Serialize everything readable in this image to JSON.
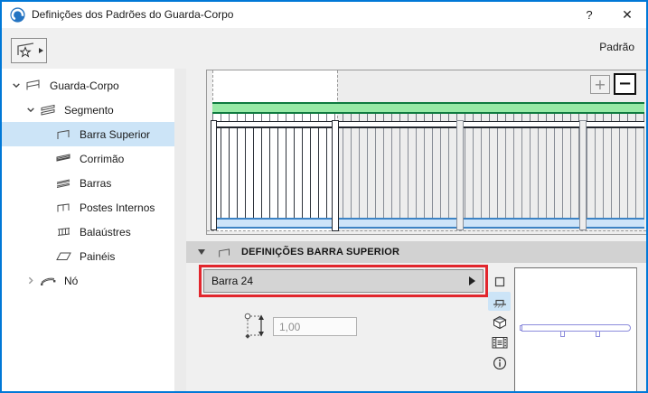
{
  "window": {
    "title": "Definições dos Padrões do Guarda-Corpo",
    "help_label": "?",
    "close_label": "✕"
  },
  "toolbar": {
    "favorites_icon": "favorites-star-icon",
    "scheme_label": "Padrão"
  },
  "tree": {
    "items": [
      {
        "label": "Guarda-Corpo",
        "level": 0,
        "icon": "railing-icon",
        "state": "expanded",
        "selected": false
      },
      {
        "label": "Segmento",
        "level": 1,
        "icon": "segment-icon",
        "state": "expanded",
        "selected": false
      },
      {
        "label": "Barra Superior",
        "level": 2,
        "icon": "top-rail-icon",
        "state": "leaf",
        "selected": true
      },
      {
        "label": "Corrimão",
        "level": 2,
        "icon": "handrail-icon",
        "state": "leaf",
        "selected": false
      },
      {
        "label": "Barras",
        "level": 2,
        "icon": "rails-icon",
        "state": "leaf",
        "selected": false
      },
      {
        "label": "Postes Internos",
        "level": 2,
        "icon": "inner-posts-icon",
        "state": "leaf",
        "selected": false
      },
      {
        "label": "Balaústres",
        "level": 2,
        "icon": "balusters-icon",
        "state": "leaf",
        "selected": false
      },
      {
        "label": "Painéis",
        "level": 2,
        "icon": "panels-icon",
        "state": "leaf",
        "selected": false
      },
      {
        "label": "Nó",
        "level": 1,
        "icon": "node-icon",
        "state": "collapsed",
        "selected": false
      }
    ]
  },
  "preview": {
    "zoom_in_label": "+",
    "zoom_out_label": "−"
  },
  "settings": {
    "section_title": "DEFINIÇÕES BARRA SUPERIOR",
    "profile_button_label": "Barra 24",
    "height_value": "1,00"
  },
  "view_toolbar": {
    "buttons": [
      {
        "icon": "plan-view-icon",
        "selected": false
      },
      {
        "icon": "front-view-icon",
        "selected": true
      },
      {
        "icon": "3d-view-icon",
        "selected": false
      },
      {
        "icon": "flythrough-icon",
        "selected": false
      },
      {
        "icon": "info-icon",
        "selected": false
      }
    ]
  },
  "colors": {
    "win_border": "#0078d7",
    "selection": "#cce4f7",
    "annotation_red": "#e2262d",
    "rail_green": "#97e9a6",
    "rail_green_border": "#0e7a3f",
    "rail_blue": "#cde4f9",
    "rail_blue_border": "#3d83c4",
    "mini_purple": "#8c8cdc"
  }
}
